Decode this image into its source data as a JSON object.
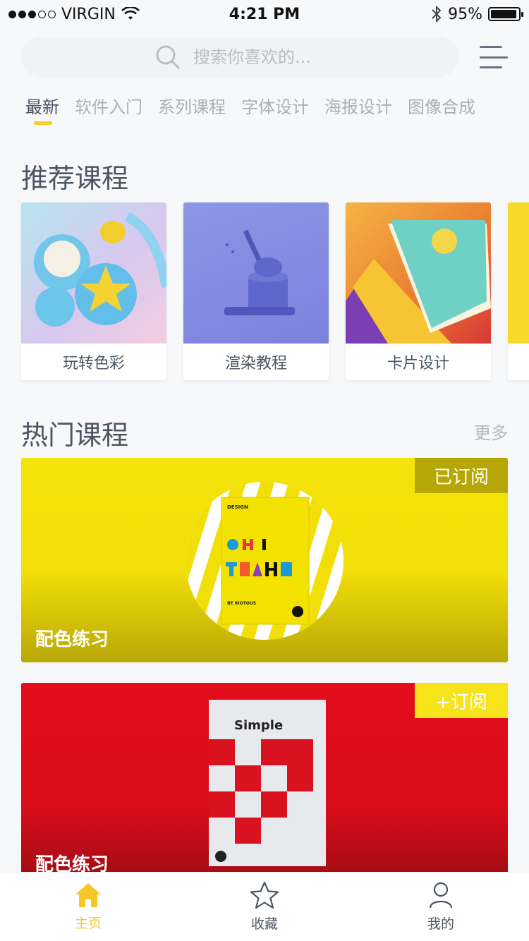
{
  "status_bar": {
    "carrier": "VIRGIN",
    "time": "4:21 PM",
    "battery_text": "95%",
    "signal_dots_filled": 3,
    "signal_dots_total": 5
  },
  "search": {
    "placeholder": "搜索你喜欢的..."
  },
  "tabs": [
    "最新",
    "软件入门",
    "系列课程",
    "字体设计",
    "海报设计",
    "图像合成"
  ],
  "recommend": {
    "title": "推荐课程",
    "cards": [
      {
        "label": "玩转色彩"
      },
      {
        "label": "渲染教程"
      },
      {
        "label": "卡片设计"
      }
    ]
  },
  "hot": {
    "title": "热门课程",
    "more": "更多",
    "courses": [
      {
        "title": "配色练习",
        "badge": "已订阅",
        "poster_text": "OH YEAH",
        "poster_caption": "BE RIOTOUS",
        "poster_header": "DESIGN"
      },
      {
        "title": "配色练习",
        "badge": "+订阅",
        "poster_text": "Simple"
      }
    ]
  },
  "tabbar": {
    "items": [
      {
        "label": "主页",
        "icon": "home-icon",
        "active": true
      },
      {
        "label": "收藏",
        "icon": "star-icon",
        "active": false
      },
      {
        "label": "我的",
        "icon": "user-icon",
        "active": false
      }
    ]
  },
  "colors": {
    "accent": "#f6cf2b",
    "yellow_card": "#f5e40a",
    "red_card": "#e30d1c"
  }
}
